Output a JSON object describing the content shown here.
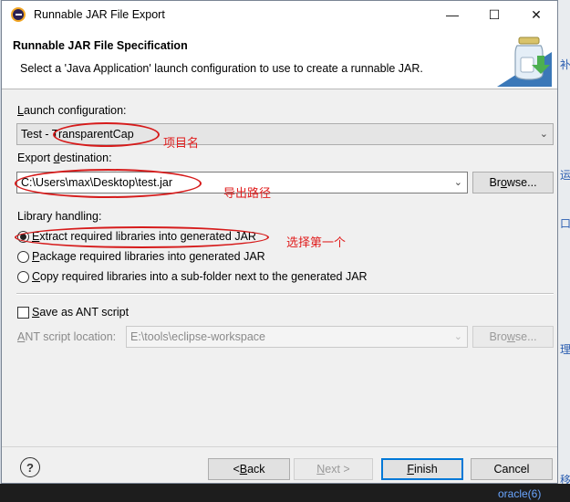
{
  "window": {
    "title": "Runnable JAR File Export",
    "minimize": "—",
    "maximize": "☐",
    "close": "✕"
  },
  "header": {
    "title": "Runnable JAR File Specification",
    "description": "Select a 'Java Application' launch configuration to use to create a runnable JAR."
  },
  "launch": {
    "label_pre": "",
    "label_u": "L",
    "label_post": "aunch configuration:",
    "value": "Test - TransparentCap"
  },
  "export": {
    "label_pre": "Export ",
    "label_u": "d",
    "label_post": "estination:",
    "value": "C:\\Users\\max\\Desktop\\test.jar",
    "browse_pre": "Br",
    "browse_u": "o",
    "browse_post": "wse..."
  },
  "library": {
    "label": "Library handling:",
    "options": [
      {
        "pre": "",
        "u": "E",
        "post": "xtract required libraries into generated JAR",
        "selected": true
      },
      {
        "pre": "",
        "u": "P",
        "post": "ackage required libraries into generated JAR",
        "selected": false
      },
      {
        "pre": "",
        "u": "C",
        "post": "opy required libraries into a sub-folder next to the generated JAR",
        "selected": false
      }
    ]
  },
  "ant": {
    "checkbox_pre": "",
    "checkbox_u": "S",
    "checkbox_post": "ave as ANT script",
    "checked": false,
    "location_label_pre": "",
    "location_label_u": "A",
    "location_label_post": "NT script location:",
    "location_value": "E:\\tools\\eclipse-workspace",
    "browse_pre": "Bro",
    "browse_u": "w",
    "browse_post": "se..."
  },
  "annotations": {
    "project_name": "项目名",
    "export_path": "导出路径",
    "choose_first": "选择第一个"
  },
  "footer": {
    "help": "?",
    "back_pre": "< ",
    "back_u": "B",
    "back_post": "ack",
    "next_pre": "",
    "next_u": "N",
    "next_post": "ext >",
    "finish_pre": "",
    "finish_u": "F",
    "finish_post": "inish",
    "cancel": "Cancel"
  },
  "background": {
    "side_texts": [
      "补",
      "运",
      "口",
      "理",
      "移"
    ],
    "bottom_link": "oracle(6)"
  },
  "colors": {
    "annotation_red": "#d61b1b",
    "default_button_border": "#0078d7",
    "dialog_bg": "#f0f0f0"
  }
}
